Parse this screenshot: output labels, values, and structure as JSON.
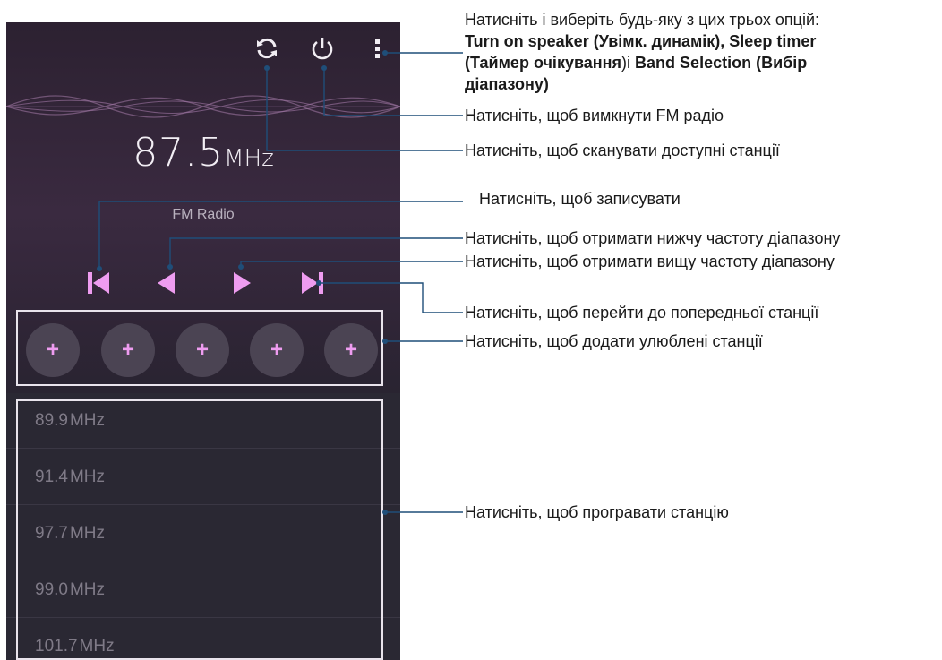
{
  "screen": {
    "frequency": "87.5",
    "frequency_unit": "MHz",
    "band": "FM Radio",
    "favorites": [
      "+",
      "+",
      "+",
      "+",
      "+"
    ],
    "stations": [
      {
        "value": "89.9",
        "unit": "MHz"
      },
      {
        "value": "91.4",
        "unit": "MHz"
      },
      {
        "value": "97.7",
        "unit": "MHz"
      },
      {
        "value": "99.0",
        "unit": "MHz"
      },
      {
        "value": "101.7",
        "unit": "MHz"
      }
    ],
    "icons": {
      "scan": "refresh-icon",
      "power": "power-icon",
      "menu": "more-vertical-icon",
      "record": "skip-first-icon",
      "lower": "triangle-left-icon",
      "higher": "triangle-right-icon",
      "previous_station": "skip-last-icon"
    },
    "colors": {
      "accent": "#ee9cf0",
      "bg_top": "#2c2131",
      "bg_list": "#2a2833",
      "callout_line": "#1f4e79"
    }
  },
  "callouts": {
    "menu_intro": "Натисніть і виберіть будь-яку з цих трьох опцій:",
    "menu_opt1": "Turn on speaker (Увімк. динамік), Sleep timer",
    "menu_opt2a": "(Таймер очікування",
    "menu_opt2b": ")і ",
    "menu_opt2c": "Band Selection (Вибір",
    "menu_opt3": "діапазону)",
    "power": "Натисніть, щоб вимкнути FM радіо",
    "scan": "Натисніть, щоб сканувати доступні станції",
    "record": "Натисніть, щоб записувати",
    "lower": "Натисніть, щоб отримати нижчу частоту діапазону",
    "higher": "Натисніть, щоб отримати вищу частоту діапазону",
    "previous": "Натисніть, щоб перейти до попередньої станції",
    "favorites": "Натисніть, щоб додати улюблені станції",
    "play": "Натисніть, щоб програвати станцію"
  }
}
